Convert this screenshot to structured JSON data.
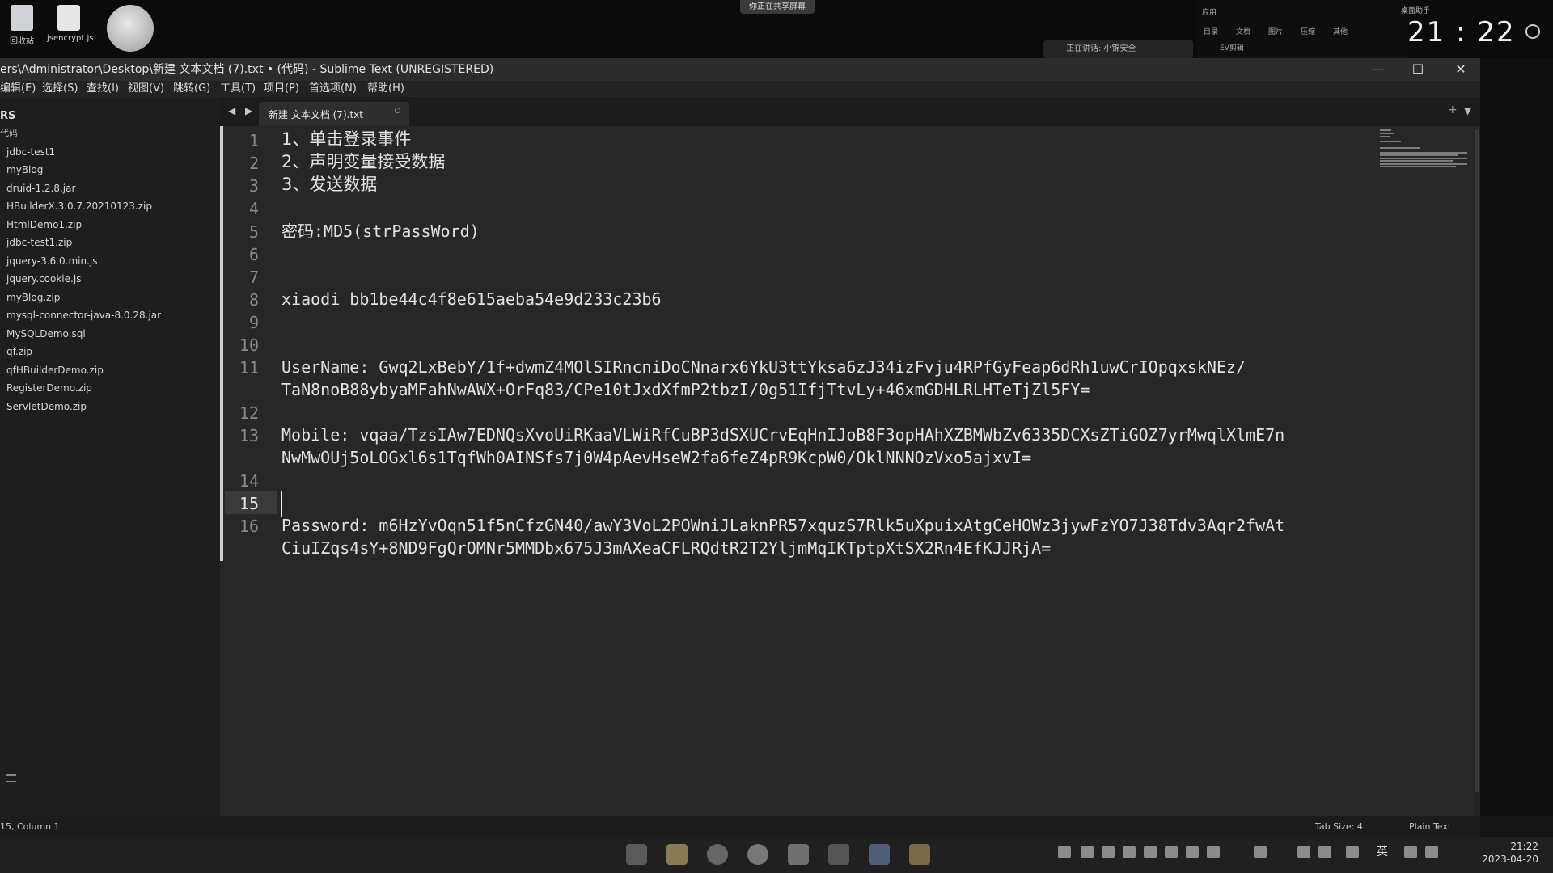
{
  "desktop": {
    "icons": [
      {
        "label": "回收站",
        "icon": "recycle-bin-icon"
      },
      {
        "label": "jsencrypt.js",
        "icon": "js-file-icon"
      }
    ],
    "share_banner": "你正在共享屏幕",
    "mic_status": "正在讲话: 小锦安全",
    "clock": "21 : 22",
    "clock_label": "桌面助手",
    "widget_labels": [
      "应用",
      "目录",
      "文档",
      "图片",
      "压缩",
      "其他"
    ],
    "widget_title": "EV剪辑"
  },
  "window": {
    "title": "ers\\Administrator\\Desktop\\新建 文本文档 (7).txt • (代码) - Sublime Text (UNREGISTERED)"
  },
  "menu": [
    "编辑(E)",
    "选择(S)",
    "查找(I)",
    "视图(V)",
    "跳转(G)",
    "工具(T)",
    "项目(P)",
    "首选项(N)",
    "帮助(H)"
  ],
  "sidebar": {
    "header": "RS",
    "subheader": "代码",
    "files": [
      "jdbc-test1",
      "myBlog",
      "druid-1.2.8.jar",
      "HBuilderX.3.0.7.20210123.zip",
      "HtmlDemo1.zip",
      "jdbc-test1.zip",
      "jquery-3.6.0.min.js",
      "jquery.cookie.js",
      "myBlog.zip",
      "mysql-connector-java-8.0.28.jar",
      "MySQLDemo.sql",
      "qf.zip",
      "qfHBuilderDemo.zip",
      "RegisterDemo.zip",
      "ServletDemo.zip"
    ]
  },
  "tabs": {
    "arrows": "◀ ▶",
    "active_label": "新建 文本文档 (7).txt",
    "plus": "+",
    "chevron": "▼"
  },
  "editor": {
    "line_numbers": [
      "1",
      "2",
      "3",
      "4",
      "5",
      "6",
      "7",
      "8",
      "9",
      "10",
      "11",
      "",
      "12",
      "13",
      "",
      "14",
      "15",
      "16",
      ""
    ],
    "current_line": "15",
    "lines": [
      "1、单击登录事件",
      "2、声明变量接受数据",
      "3、发送数据",
      "",
      "密码:MD5(strPassWord)",
      "",
      "",
      "xiaodi bb1be44c4f8e615aeba54e9d233c23b6",
      "",
      "",
      "UserName: Gwq2LxBebY/1f+dwmZ4MOlSIRncniDoCNnarx6YkU3ttYksa6zJ34izFvju4RPfGyFeap6dRh1uwCrIOpqxskNEz/",
      "TaN8noB88ybyaMFahNwAWX+OrFq83/CPe10tJxdXfmP2tbzI/0g51IfjTtvLy+46xmGDHLRLHTeTjZl5FY=",
      "",
      "Mobile: vqaa/TzsIAw7EDNQsXvoUiRKaaVLWiRfCuBP3dSXUCrvEqHnIJoB8F3opHAhXZBMWbZv6335DCXsZTiGOZ7yrMwqlXlmE7n",
      "NwMwOUj5oLOGxl6s1TqfWh0AINSfs7j0W4pAevHseW2fa6feZ4pR9KcpW0/OklNNNOzVxo5ajxvI=",
      "",
      "",
      "Password: m6HzYvOqn51f5nCfzGN40/awY3VoL2POWniJLaknPR57xquzS7Rlk5uXpuixAtgCeHOWz3jywFzYO7J38Tdv3Aqr2fwAt",
      "CiuIZqs4sY+8ND9FgQrOMNr5MMDbx675J3mAXeaCFLRQdtR2T2YljmMqIKTptpXtSX2Rn4EfKJJRjA="
    ]
  },
  "status": {
    "position": "15, Column 1",
    "tab_size": "Tab Size: 4",
    "syntax": "Plain Text"
  },
  "taskbar": {
    "time": "21:22",
    "date": "2023-04-20",
    "lang": "英"
  }
}
